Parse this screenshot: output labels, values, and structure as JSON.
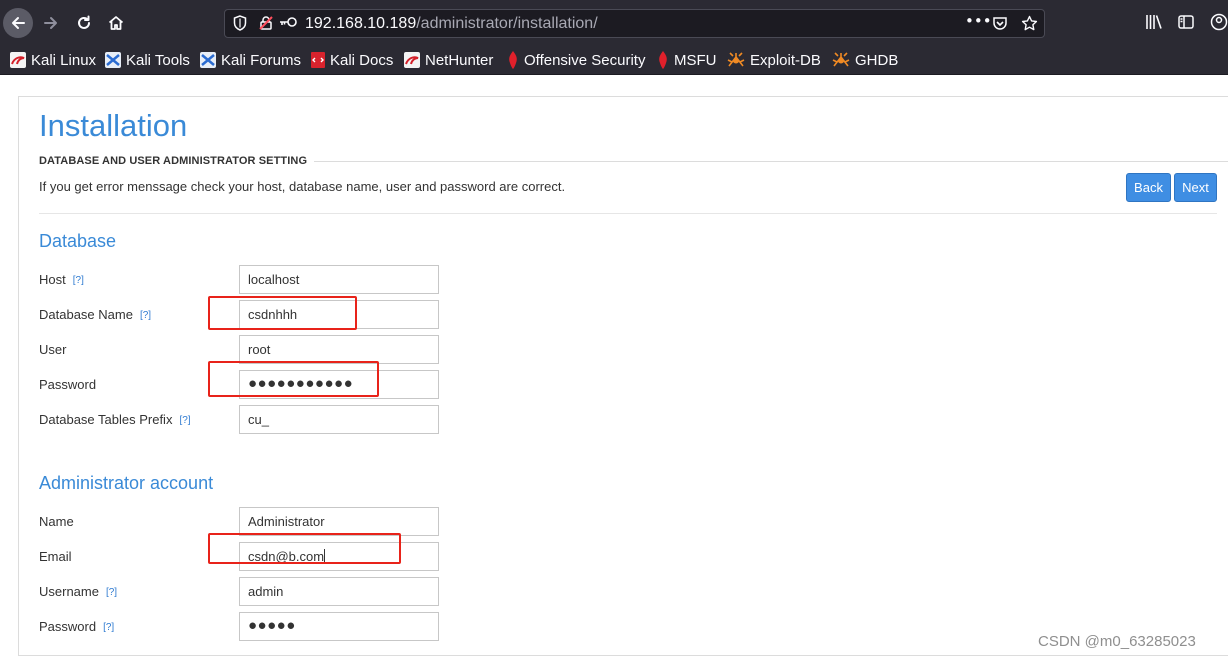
{
  "browser": {
    "url_host": "192.168.10.189",
    "url_path": "/administrator/installation/",
    "url_menu": "•••"
  },
  "bookmarks": [
    {
      "label": "Kali Linux",
      "icon": "kali-dragon-icon"
    },
    {
      "label": "Kali Tools",
      "icon": "kali-tools-icon"
    },
    {
      "label": "Kali Forums",
      "icon": "kali-forums-icon"
    },
    {
      "label": "Kali Docs",
      "icon": "kali-docs-icon"
    },
    {
      "label": "NetHunter",
      "icon": "nethunter-icon"
    },
    {
      "label": "Offensive Security",
      "icon": "offsec-icon"
    },
    {
      "label": "MSFU",
      "icon": "msfu-icon"
    },
    {
      "label": "Exploit-DB",
      "icon": "exploitdb-icon"
    },
    {
      "label": "GHDB",
      "icon": "ghdb-icon"
    }
  ],
  "page": {
    "title": "Installation",
    "subtitle": "DATABASE AND USER ADMINISTRATOR SETTING",
    "hint": "If you get error menssage check your host, database name, user and password are correct.",
    "back_label": "Back",
    "next_label": "Next",
    "help_marker": "[?]"
  },
  "database": {
    "heading": "Database",
    "host_label": "Host",
    "host_value": "localhost",
    "name_label": "Database Name",
    "name_value": "csdnhhh",
    "user_label": "User",
    "user_value": "root",
    "password_label": "Password",
    "password_value": "●●●●●●●●●●●",
    "prefix_label": "Database Tables Prefix",
    "prefix_value": "cu_"
  },
  "admin": {
    "heading": "Administrator account",
    "name_label": "Name",
    "name_value": "Administrator",
    "email_label": "Email",
    "email_value": "csdn@b.com",
    "username_label": "Username",
    "username_value": "admin",
    "password_label": "Password",
    "password_value": "●●●●●"
  },
  "watermark": "CSDN @m0_63285023",
  "colors": {
    "accent": "#3a8ad7",
    "button": "#3f8ee3",
    "annotation_red": "#e8231a",
    "chrome": "#2b2a33"
  }
}
